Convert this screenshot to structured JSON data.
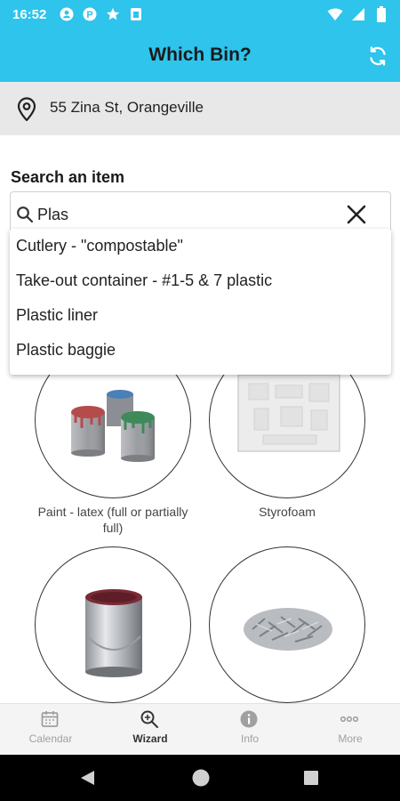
{
  "status_bar": {
    "time": "16:52",
    "left_icons": [
      "account-circle-icon",
      "parking-icon",
      "star-icon",
      "sim-card-icon"
    ],
    "right_icons": [
      "wifi-icon",
      "signal-icon",
      "battery-icon"
    ]
  },
  "app_bar": {
    "title": "Which Bin?",
    "background": "#2ec4ec",
    "action_icon": "refresh-icon"
  },
  "address": {
    "icon": "location-pin-icon",
    "text": "55 Zina St, Orangeville"
  },
  "search": {
    "label": "Search an item",
    "value": "Plas",
    "clear_icon": "close-icon"
  },
  "suggestions": [
    "Cutlery - \"compostable\"",
    "Take-out container - #1-5 & 7 plastic",
    "Plastic liner",
    "Plastic baggie"
  ],
  "tiles": [
    {
      "caption": "Paint - latex (full or partially full)",
      "image": "paint-cans"
    },
    {
      "caption": "Styrofoam",
      "image": "styrofoam"
    },
    {
      "caption": "",
      "image": "metal-paint-can"
    },
    {
      "caption": "",
      "image": "metal-scraps"
    }
  ],
  "bottom_nav": {
    "items": [
      {
        "label": "Calendar",
        "icon": "calendar-icon",
        "active": false
      },
      {
        "label": "Wizard",
        "icon": "wizard-search-icon",
        "active": true
      },
      {
        "label": "Info",
        "icon": "info-icon",
        "active": false
      },
      {
        "label": "More",
        "icon": "more-dots-icon",
        "active": false
      }
    ]
  },
  "system_nav": [
    "back-icon",
    "home-icon",
    "recents-icon"
  ]
}
